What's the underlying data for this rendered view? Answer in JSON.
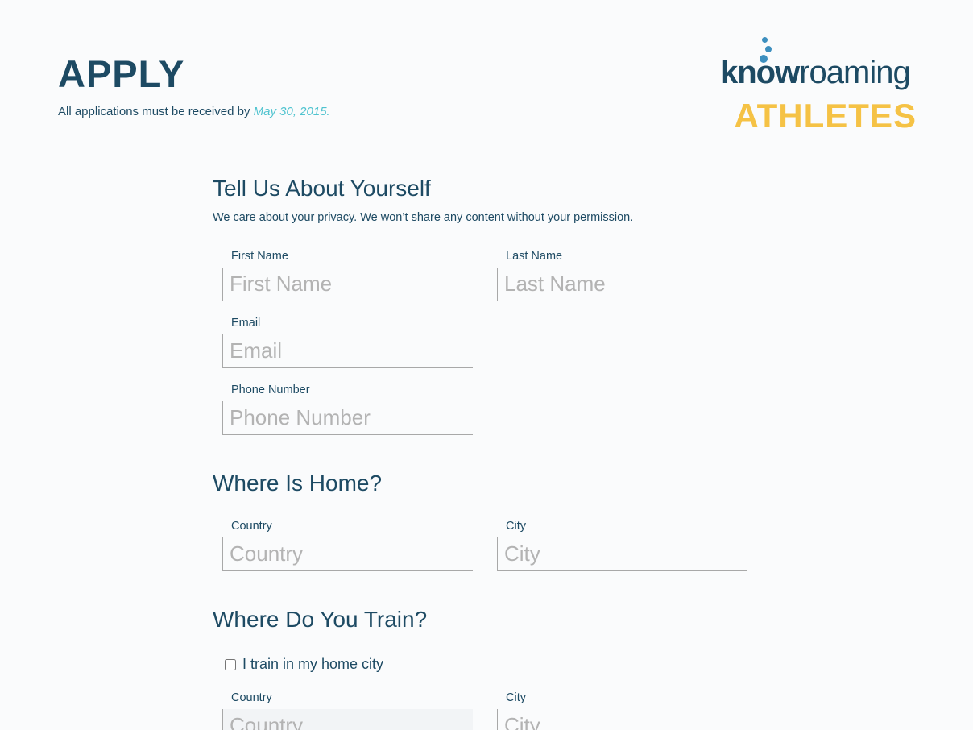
{
  "header": {
    "title": "APPLY",
    "deadline_prefix": "All applications must be received by",
    "deadline_date": "May 30, 2015."
  },
  "logo": {
    "word_bold": "know",
    "word_thin": "roaming",
    "tagline": "ATHLETES",
    "colors": {
      "navy": "#1d4a63",
      "blue": "#3d8fbf",
      "yellow": "#f5c245"
    }
  },
  "about": {
    "title": "Tell Us About Yourself",
    "subtitle": "We care about your privacy. We won’t share any content without your permission.",
    "first_name": {
      "label": "First Name",
      "placeholder": "First Name",
      "value": ""
    },
    "last_name": {
      "label": "Last Name",
      "placeholder": "Last Name",
      "value": ""
    },
    "email": {
      "label": "Email",
      "placeholder": "Email",
      "value": ""
    },
    "phone": {
      "label": "Phone Number",
      "placeholder": "Phone Number",
      "value": ""
    }
  },
  "home": {
    "title": "Where Is Home?",
    "country": {
      "label": "Country",
      "placeholder": "Country",
      "value": ""
    },
    "city": {
      "label": "City",
      "placeholder": "City",
      "value": ""
    }
  },
  "train": {
    "title": "Where Do You Train?",
    "checkbox_label": "I train in my home city",
    "checked": false,
    "country": {
      "label": "Country",
      "placeholder": "Country",
      "value": ""
    },
    "city": {
      "label": "City",
      "placeholder": "City",
      "value": ""
    }
  },
  "colors": {
    "accent": "#4fc3cf",
    "text": "#1d4a63",
    "background": "#fafbfc"
  }
}
